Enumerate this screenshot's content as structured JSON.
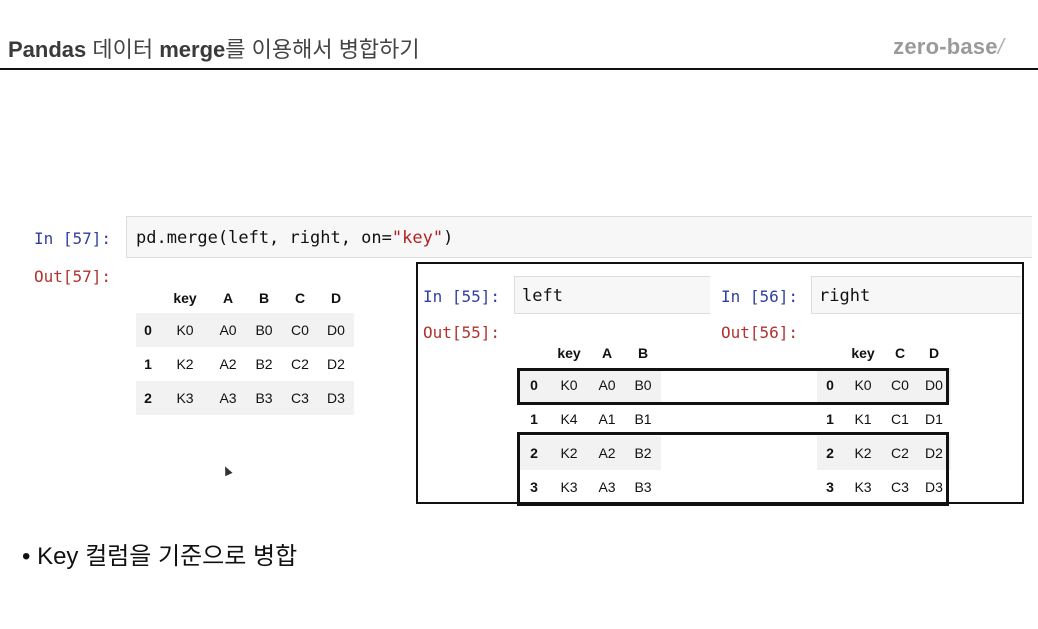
{
  "header": {
    "title_part1": "Pandas",
    "title_part2": " 데이터 ",
    "title_part3": "merge",
    "title_part4": "를 이용해서 병합하기",
    "brand": "zero-base",
    "brand_slash": "/"
  },
  "cell57": {
    "in_prompt": "In [57]:",
    "code_prefix": "pd.merge(left, right, on=",
    "code_string": "\"key\"",
    "code_suffix": ")",
    "out_prompt": "Out[57]:",
    "table": {
      "columns": [
        "key",
        "A",
        "B",
        "C",
        "D"
      ],
      "rows": [
        {
          "index": "0",
          "cells": [
            "K0",
            "A0",
            "B0",
            "C0",
            "D0"
          ]
        },
        {
          "index": "1",
          "cells": [
            "K2",
            "A2",
            "B2",
            "C2",
            "D2"
          ]
        },
        {
          "index": "2",
          "cells": [
            "K3",
            "A3",
            "B3",
            "C3",
            "D3"
          ]
        }
      ]
    }
  },
  "cell55": {
    "in_prompt": "In [55]:",
    "code": "left",
    "out_prompt": "Out[55]:",
    "table": {
      "columns": [
        "key",
        "A",
        "B"
      ],
      "rows": [
        {
          "index": "0",
          "cells": [
            "K0",
            "A0",
            "B0"
          ]
        },
        {
          "index": "1",
          "cells": [
            "K4",
            "A1",
            "B1"
          ]
        },
        {
          "index": "2",
          "cells": [
            "K2",
            "A2",
            "B2"
          ]
        },
        {
          "index": "3",
          "cells": [
            "K3",
            "A3",
            "B3"
          ]
        }
      ]
    }
  },
  "cell56": {
    "in_prompt": "In [56]:",
    "code": "right",
    "out_prompt": "Out[56]:",
    "table": {
      "columns": [
        "key",
        "C",
        "D"
      ],
      "rows": [
        {
          "index": "0",
          "cells": [
            "K0",
            "C0",
            "D0"
          ]
        },
        {
          "index": "1",
          "cells": [
            "K1",
            "C1",
            "D1"
          ]
        },
        {
          "index": "2",
          "cells": [
            "K2",
            "C2",
            "D2"
          ]
        },
        {
          "index": "3",
          "cells": [
            "K3",
            "C3",
            "D3"
          ]
        }
      ]
    }
  },
  "bullet": "• Key 컬럼을 기준으로 병합",
  "colors": {
    "in_prompt": "#303f9f",
    "out_prompt": "#b0332f",
    "string": "#b22222",
    "stripe": "#f2f2f2"
  }
}
